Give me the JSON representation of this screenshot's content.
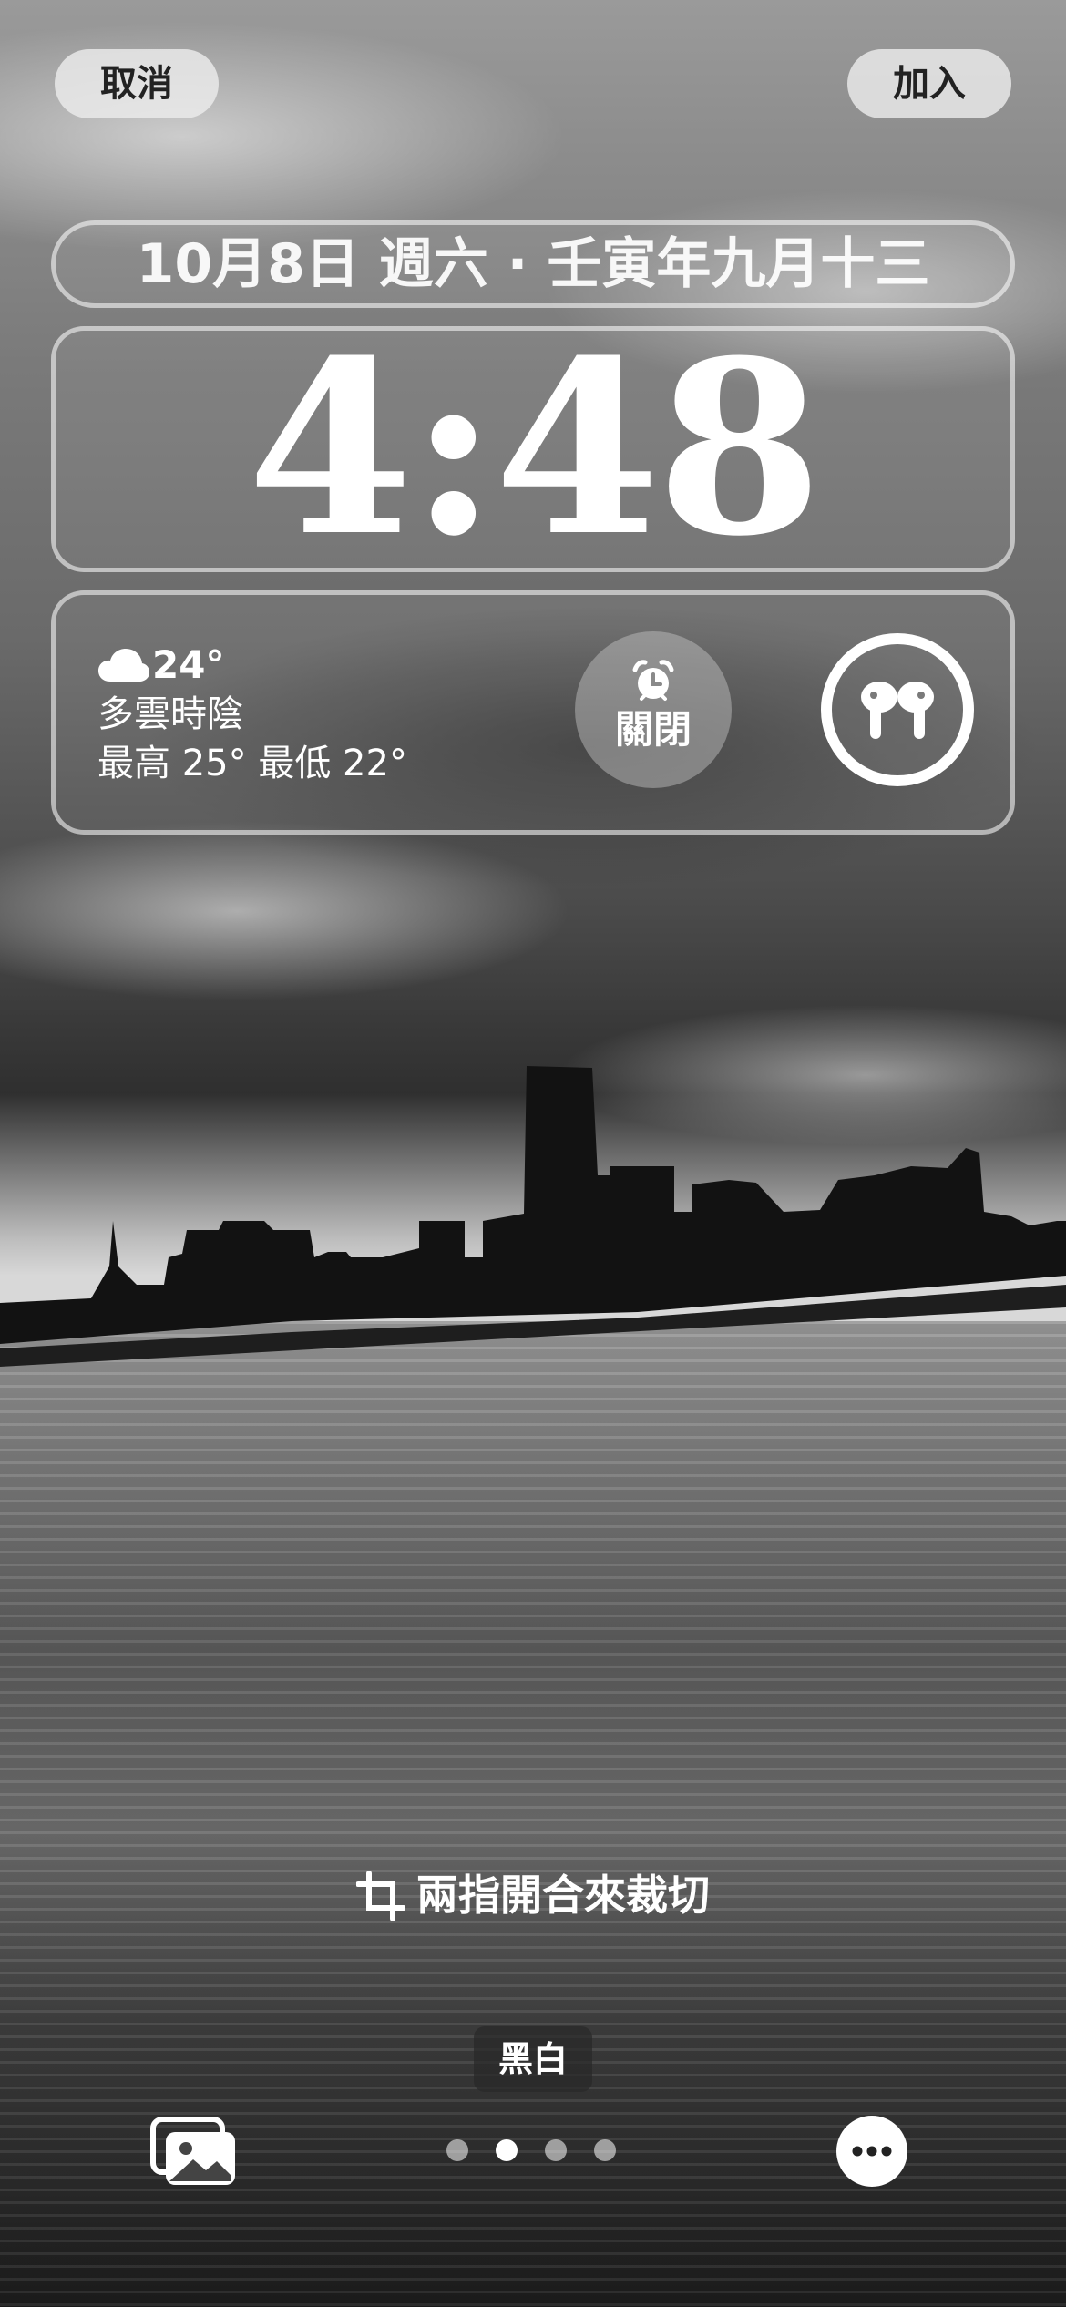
{
  "top_bar": {
    "cancel_label": "取消",
    "add_label": "加入"
  },
  "lock_screen": {
    "date": "10月8日 週六 · 壬寅年九月十三",
    "time": "4:48"
  },
  "widgets": {
    "weather": {
      "icon": "cloud-icon",
      "temperature": "24°",
      "condition": "多雲時陰",
      "high_low": "最高 25° 最低 22°"
    },
    "alarm": {
      "icon": "alarm-clock-icon",
      "status": "關閉"
    },
    "airpods": {
      "icon": "airpods-icon",
      "battery_fraction": 1.0
    }
  },
  "editor": {
    "crop_icon": "crop-icon",
    "crop_hint": "兩指開合來裁切",
    "filter_name": "黑白",
    "page_count": 4,
    "active_page": 1,
    "photos_icon": "photo-library-icon",
    "more_icon": "ellipsis-icon"
  }
}
